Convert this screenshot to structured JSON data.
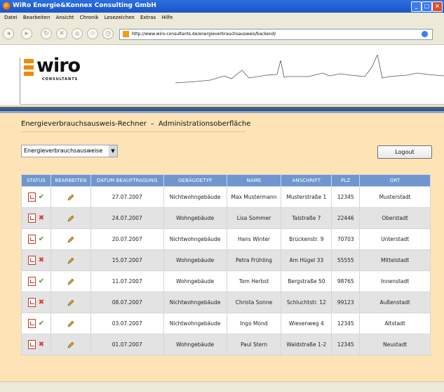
{
  "window": {
    "title": "WiRo Energie&Konnex Consulting GmbH"
  },
  "menu": [
    "Datei",
    "Bearbeiten",
    "Ansicht",
    "Chronik",
    "Lesezeichen",
    "Extras",
    "Hilfe"
  ],
  "url": "http://www.wiro-consultants.de/energieverbrauchsausweis/backend/",
  "logo": {
    "name": "wiro",
    "sub": "CONSULTANTS"
  },
  "page": {
    "title": "Energieverbrauchsausweis-Rechner",
    "dash": "–",
    "subtitle": "Administrationsoberfläche"
  },
  "dropdown": {
    "selected": "Energieverbrauchsausweise"
  },
  "logout_label": "Logout",
  "table": {
    "headers": [
      "STATUS",
      "BEARBEITEN",
      "DATUM BEAUFTRAGUNG",
      "GEBÄUDETYP",
      "NAME",
      "ANSCHRIFT",
      "PLZ",
      "ORT"
    ],
    "rows": [
      {
        "status": "ok",
        "date": "27.07.2007",
        "type": "Nichtwohngebäude",
        "name": "Max Mustermann",
        "addr": "Musterstraße 1",
        "plz": "12345",
        "ort": "Musterstadt"
      },
      {
        "status": "fail",
        "date": "24.07.2007",
        "type": "Wohngebäude",
        "name": "Lisa Sommer",
        "addr": "Talstraße 7",
        "plz": "22446",
        "ort": "Oberstadt"
      },
      {
        "status": "ok",
        "date": "20.07.2007",
        "type": "Nichtwohngebäude",
        "name": "Hans Winter",
        "addr": "Brückenstr. 9",
        "plz": "70703",
        "ort": "Unterstadt"
      },
      {
        "status": "fail",
        "date": "15.07.2007",
        "type": "Wohngebäude",
        "name": "Petra Frühling",
        "addr": "Am Hügel 33",
        "plz": "55555",
        "ort": "Mittelstadt"
      },
      {
        "status": "ok",
        "date": "11.07.2007",
        "type": "Wohngebäude",
        "name": "Tom Herbst",
        "addr": "Bergstraße 50",
        "plz": "98765",
        "ort": "Innenstadt"
      },
      {
        "status": "fail",
        "date": "08.07.2007",
        "type": "Nichtwohngebäude",
        "name": "Christa Sonne",
        "addr": "Schluchtstr. 12",
        "plz": "99123",
        "ort": "Außenstadt"
      },
      {
        "status": "ok",
        "date": "03.07.2007",
        "type": "Nichtwohngebäude",
        "name": "Ingo Mond",
        "addr": "Wiesenweg 4",
        "plz": "12345",
        "ort": "Altstadt"
      },
      {
        "status": "fail",
        "date": "01.07.2007",
        "type": "Wohngebäude",
        "name": "Paul Stern",
        "addr": "Waldstraße 1-2",
        "plz": "12345",
        "ort": "Neustadt"
      }
    ]
  },
  "icons": {
    "pdf": "pdf-icon",
    "ok": "check-icon",
    "fail": "cross-icon",
    "edit": "pencil-icon"
  },
  "colors": {
    "header_blue": "#6f97cd",
    "content_bg": "#fde3b6",
    "logo_orange": "#f08a00"
  }
}
